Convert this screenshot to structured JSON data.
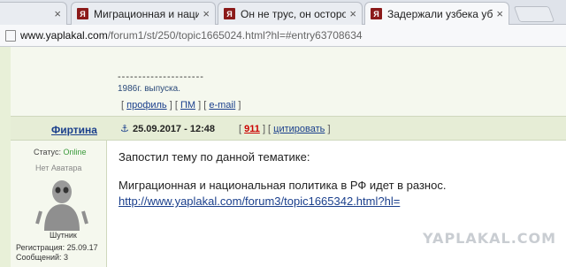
{
  "browser": {
    "tabs": [
      {
        "title": "",
        "favicon": "",
        "close": "×"
      },
      {
        "title": "Миграционная и нацис",
        "favicon": "Я",
        "close": "×"
      },
      {
        "title": "Он не трус, он осторож",
        "favicon": "Я",
        "close": "×"
      },
      {
        "title": "Задержали узбека убие",
        "favicon": "Я",
        "close": "×"
      }
    ],
    "address": {
      "host": "www.yaplakal.com",
      "path": "/forum1/st/250/topic1665024.html?hl=#entry63708634"
    }
  },
  "post_prev": {
    "dashes": "---------------------",
    "signature": "1986г. выпуска.",
    "links": {
      "open": "[",
      "profile": "профиль",
      "sep1": "] [",
      "pm": "ПМ",
      "sep2": "] [",
      "email": "e-mail",
      "close": "]"
    }
  },
  "post": {
    "author": "Фиртина",
    "anchor_icon": "⚓",
    "date": "25.09.2017 - 12:48",
    "links": {
      "open": "[",
      "number": "911",
      "sep": "] [",
      "quote": "цитировать",
      "close": "]"
    },
    "user": {
      "status_label": "Статус:",
      "status_value": "Online",
      "no_avatar": "Нет Аватара",
      "rank": "Шутник",
      "registration": "Регистрация: 25.09.17",
      "messages": "Сообщений: 3"
    },
    "text_line1": "Запостил тему по данной тематике:",
    "text_line2": "Миграционная и национальная политика в РФ идет в разнос.",
    "link": "http://www.yaplakal.com/forum3/topic1665342.html?hl="
  },
  "watermark": "YAPLAKAL.COM",
  "colors": {
    "accent": "#1a3f8c",
    "online": "#3a9a3a",
    "count": "#cc0000",
    "panel": "#f5f8ee"
  }
}
